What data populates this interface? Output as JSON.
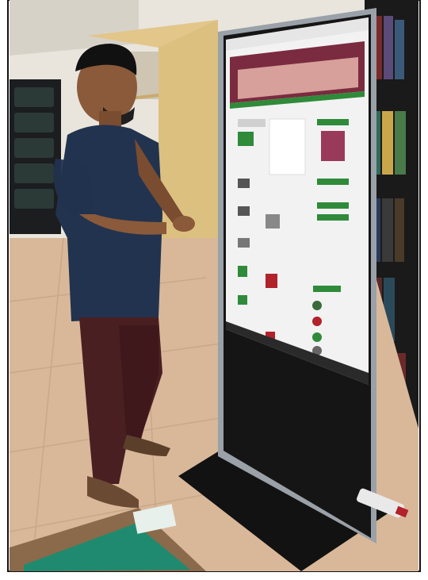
{
  "scene": {
    "kind": "photo",
    "subject": "man-in-front-of-kiosk",
    "colors": {
      "floor": "#d9b89a",
      "floor_shadow": "#b79274",
      "wall": "#e9e5dc",
      "shelf_wood": "#e2c68a",
      "shirt": "#22334f",
      "pants": "#4a1f22",
      "skin": "#8a5a3a",
      "kiosk_frame": "#9aa1a8",
      "kiosk_body": "#151515",
      "screen_bg": "#f2f2f2",
      "accent_green": "#2f8a3a",
      "accent_red": "#b1222b",
      "mat_teal": "#1f8a6f"
    }
  }
}
